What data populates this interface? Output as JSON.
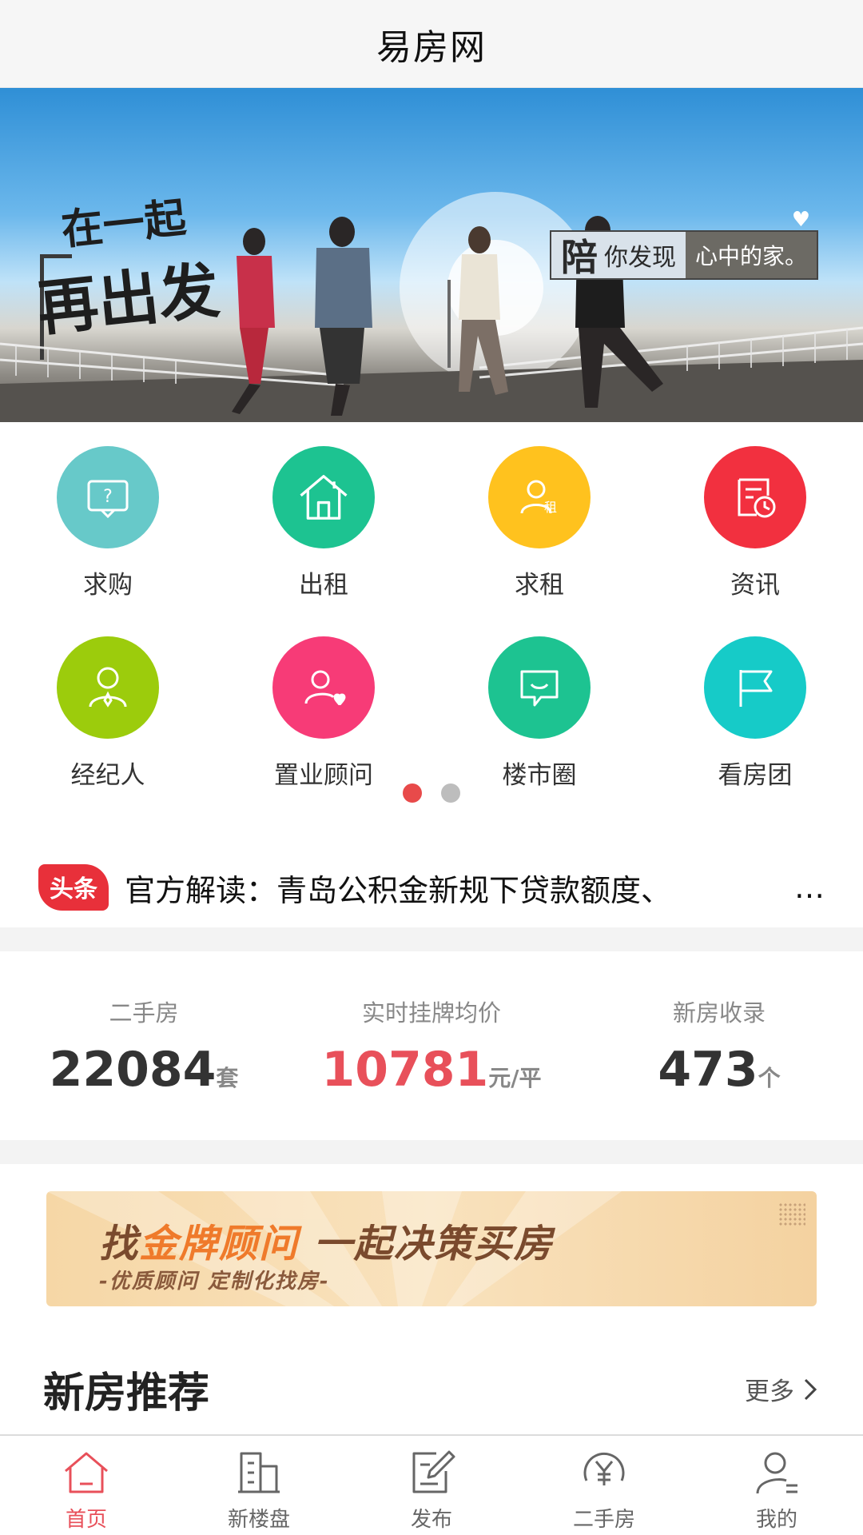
{
  "nav": {
    "title": "易房网"
  },
  "banner": {
    "slogan_line1": "在一起",
    "slogan_line2": "再出发",
    "tag_strong": "陪",
    "tag_text": "你发现",
    "tag_highlight": "心中的家。"
  },
  "grid": {
    "items": [
      {
        "label": "求购",
        "icon": "question-card-icon",
        "color": "#67c9c9"
      },
      {
        "label": "出租",
        "icon": "house-icon",
        "color": "#1dc391"
      },
      {
        "label": "求租",
        "icon": "user-rent-icon",
        "color": "#ffc21e"
      },
      {
        "label": "资讯",
        "icon": "news-clock-icon",
        "color": "#f2303f"
      },
      {
        "label": "经纪人",
        "icon": "agent-icon",
        "color": "#9ccc0c"
      },
      {
        "label": "置业顾问",
        "icon": "consultant-icon",
        "color": "#f73b77"
      },
      {
        "label": "楼市圈",
        "icon": "chat-bubble-icon",
        "color": "#1dc391"
      },
      {
        "label": "看房团",
        "icon": "flag-icon",
        "color": "#16cbc8"
      }
    ],
    "page_count": 2,
    "active_page": 1
  },
  "headline": {
    "badge": "头条",
    "text": "官方解读：青岛公积金新规下贷款额度、",
    "more": "…"
  },
  "stats": [
    {
      "label": "二手房",
      "value": "22084",
      "unit": "套"
    },
    {
      "label": "实时挂牌均价",
      "value": "10781",
      "unit": "元/平"
    },
    {
      "label": "新房收录",
      "value": "473",
      "unit": "个"
    }
  ],
  "promo": {
    "title_a": "找",
    "title_highlight": "金牌顾问",
    "title_b": " 一起决策买房",
    "subtitle": "-优质顾问 定制化找房-"
  },
  "section": {
    "title": "新房推荐",
    "more": "更多"
  },
  "tabbar": {
    "items": [
      {
        "label": "首页",
        "icon": "home-icon",
        "active": true
      },
      {
        "label": "新楼盘",
        "icon": "building-icon",
        "active": false
      },
      {
        "label": "发布",
        "icon": "edit-icon",
        "active": false
      },
      {
        "label": "二手房",
        "icon": "yen-icon",
        "active": false
      },
      {
        "label": "我的",
        "icon": "profile-icon",
        "active": false
      }
    ]
  },
  "colors": {
    "accent": "#e8505a",
    "badge": "#e8303a"
  }
}
